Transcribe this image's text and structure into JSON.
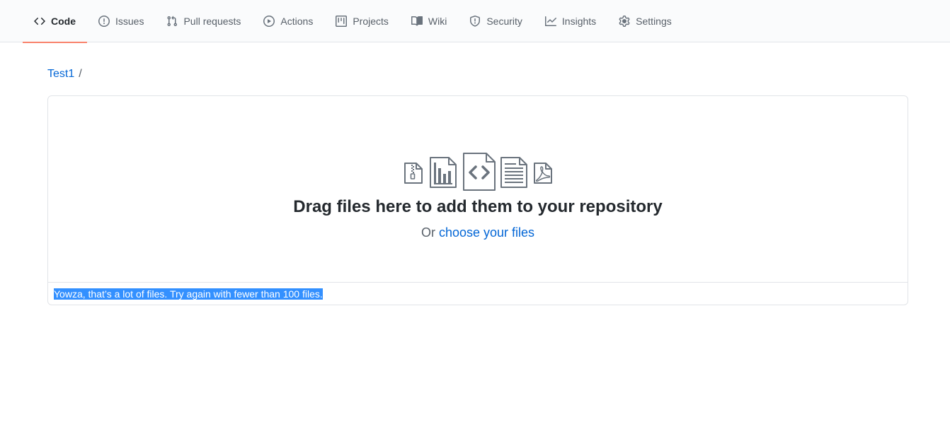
{
  "nav": {
    "tabs": [
      {
        "label": "Code",
        "icon": "code-icon",
        "selected": true
      },
      {
        "label": "Issues",
        "icon": "issue-icon",
        "selected": false
      },
      {
        "label": "Pull requests",
        "icon": "pull-request-icon",
        "selected": false
      },
      {
        "label": "Actions",
        "icon": "play-icon",
        "selected": false
      },
      {
        "label": "Projects",
        "icon": "project-icon",
        "selected": false
      },
      {
        "label": "Wiki",
        "icon": "book-icon",
        "selected": false
      },
      {
        "label": "Security",
        "icon": "shield-icon",
        "selected": false
      },
      {
        "label": "Insights",
        "icon": "graph-icon",
        "selected": false
      },
      {
        "label": "Settings",
        "icon": "gear-icon",
        "selected": false
      }
    ]
  },
  "breadcrumb": {
    "repo": "Test1",
    "separator": "/"
  },
  "upload": {
    "title": "Drag files here to add them to your repository",
    "prefix": "Or",
    "link": "choose your files",
    "icons": [
      "file-zip-icon",
      "file-chart-icon",
      "file-code-icon",
      "file-text-icon",
      "file-pdf-icon"
    ]
  },
  "error": {
    "message": "Yowza, that’s a lot of files. Try again with fewer than 100 files."
  },
  "colors": {
    "accent_underline": "#f9826c",
    "link": "#0366d6",
    "selection": "#3390ff"
  }
}
